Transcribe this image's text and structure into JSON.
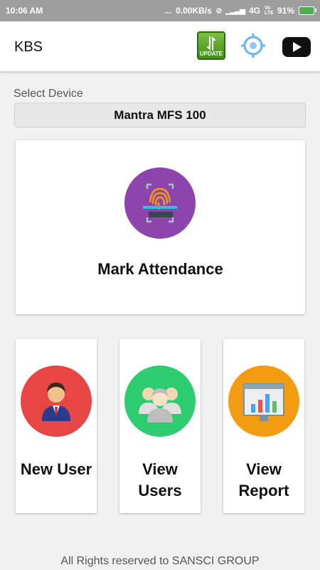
{
  "status": {
    "time": "10:06 AM",
    "dots": "...",
    "speed": "0.00KB/s",
    "network": "4G",
    "volte": "Vo LTE",
    "battery": "91%"
  },
  "appbar": {
    "title": "KBS",
    "update_label": "UPDATE"
  },
  "device": {
    "label": "Select Device",
    "selected": "Mantra MFS 100"
  },
  "attendance": {
    "label": "Mark Attendance",
    "color": "#8e44ad"
  },
  "tiles": [
    {
      "line1": "New User",
      "line2": "",
      "color": "#e84545",
      "icon": "user-icon"
    },
    {
      "line1": "View",
      "line2": "Users",
      "color": "#2ecc71",
      "icon": "users-group-icon"
    },
    {
      "line1": "View",
      "line2": "Report",
      "color": "#f39c12",
      "icon": "report-chart-icon"
    }
  ],
  "footer": "All Rights reserved to SANSCI GROUP"
}
